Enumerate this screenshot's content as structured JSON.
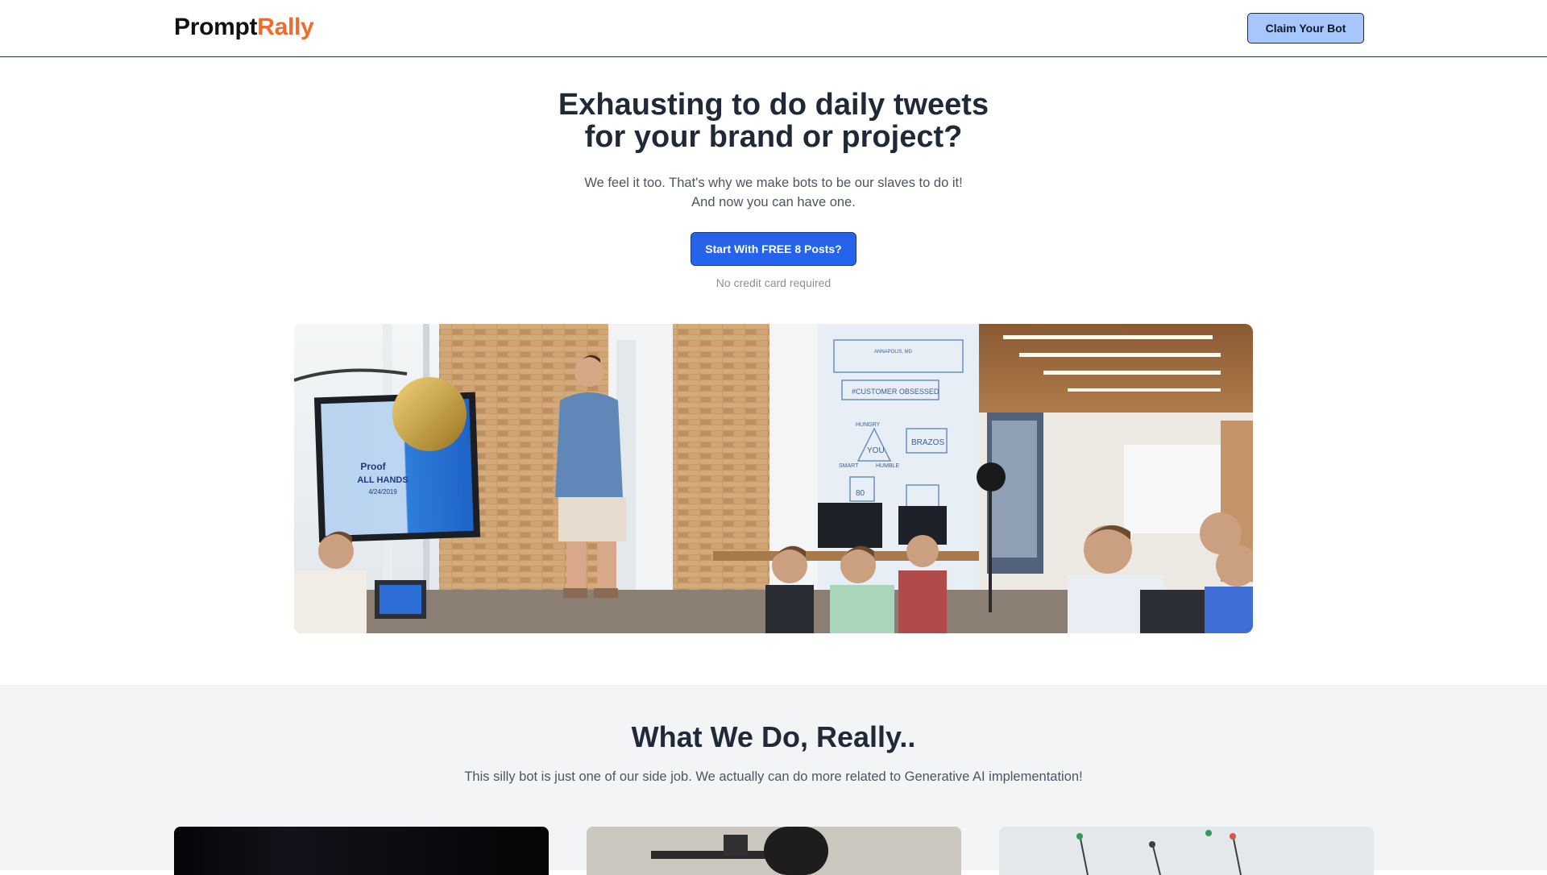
{
  "header": {
    "logo_part1": "Prompt",
    "logo_part2": "Rally",
    "claim_button": "Claim Your Bot"
  },
  "hero": {
    "title_line1": "Exhausting to do daily tweets",
    "title_line2": "for your brand or project?",
    "subtitle_line1": "We feel it too. That's why we make bots to be our slaves to do it!",
    "subtitle_line2": "And now you can have one.",
    "cta_button": "Start With FREE 8 Posts?",
    "cta_note": "No credit card required",
    "image_screen_text": [
      "Proof",
      "ALL HANDS",
      "4/24/2019"
    ],
    "image_wall_texts": [
      "#CUSTOMER OBSESSED",
      "BRAZOS",
      "YOU",
      "HUNGRY",
      "SMART",
      "HUMBLE",
      "80",
      "ANNAPOLIS, MD"
    ]
  },
  "section_what": {
    "title": "What We Do, Really..",
    "subtitle": "This silly bot is just one of our side job. We actually can do more related to Generative AI implementation!"
  },
  "colors": {
    "brand_accent": "#f26b2a",
    "primary_button": "#2563eb",
    "secondary_button": "#a7c6fb",
    "section_bg": "#f3f4f6"
  }
}
